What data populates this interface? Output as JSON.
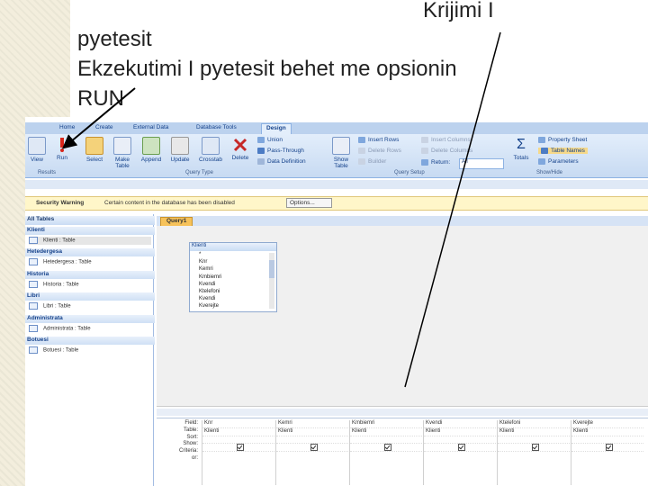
{
  "slide": {
    "title": "Krijimi I",
    "line1": "pyetesit",
    "line2": "Ekzekutimi I pyetesit behet me opsionin",
    "line3": "RUN"
  },
  "ribbon": {
    "tabs": [
      "Home",
      "Create",
      "External Data",
      "Database Tools",
      "Design"
    ],
    "results_group": "Results",
    "query_type_group": "Query Type",
    "query_setup_group": "Query Setup",
    "show_hide_group": "Show/Hide",
    "buttons": {
      "view": "View",
      "run": "Run",
      "select": "Select",
      "make_table": "Make Table",
      "append": "Append",
      "update": "Update",
      "crosstab": "Crosstab",
      "delete": "Delete",
      "union": "Union",
      "pass_through": "Pass-Through",
      "data_definition": "Data Definition",
      "show_table": "Show Table",
      "insert_rows": "Insert Rows",
      "delete_rows": "Delete Rows",
      "builder": "Builder",
      "insert_columns": "Insert Columns",
      "delete_columns": "Delete Columns",
      "return": "Return:",
      "return_value": "All",
      "totals": "Totals",
      "property_sheet": "Property Sheet",
      "table_names": "Table Names",
      "parameters": "Parameters"
    }
  },
  "security_bar": {
    "label": "Security Warning",
    "message": "Certain content in the database has been disabled",
    "options": "Options..."
  },
  "nav_pane": {
    "header": "All Tables",
    "groups": [
      {
        "name": "Klienti",
        "item": "Klienti : Table"
      },
      {
        "name": "Hetedergesa",
        "item": "Hetedergesa : Table"
      },
      {
        "name": "Historia",
        "item": "Historia : Table"
      },
      {
        "name": "Libri",
        "item": "Libri : Table"
      },
      {
        "name": "Administrata",
        "item": "Administrata : Table"
      },
      {
        "name": "Botuesi",
        "item": "Botuesi : Table"
      }
    ]
  },
  "query": {
    "tab": "Query1",
    "table_box": {
      "title": "Klienti",
      "fields": [
        "*",
        "Knr",
        "Kemri",
        "Kmbiemri",
        "Kvendi",
        "Ktelefoni",
        "Kvendi",
        "Kverejte"
      ]
    },
    "grid_row_labels": [
      "Field:",
      "Table:",
      "Sort:",
      "Show:",
      "Criteria:",
      "or:"
    ],
    "columns": [
      {
        "field": "Knr",
        "table": "Klienti"
      },
      {
        "field": "Kemri",
        "table": "Klienti"
      },
      {
        "field": "Kmbiemri",
        "table": "Klienti"
      },
      {
        "field": "Kvendi",
        "table": "Klienti"
      },
      {
        "field": "Ktelefoni",
        "table": "Klienti"
      },
      {
        "field": "Kverejte",
        "table": "Klienti"
      }
    ]
  }
}
